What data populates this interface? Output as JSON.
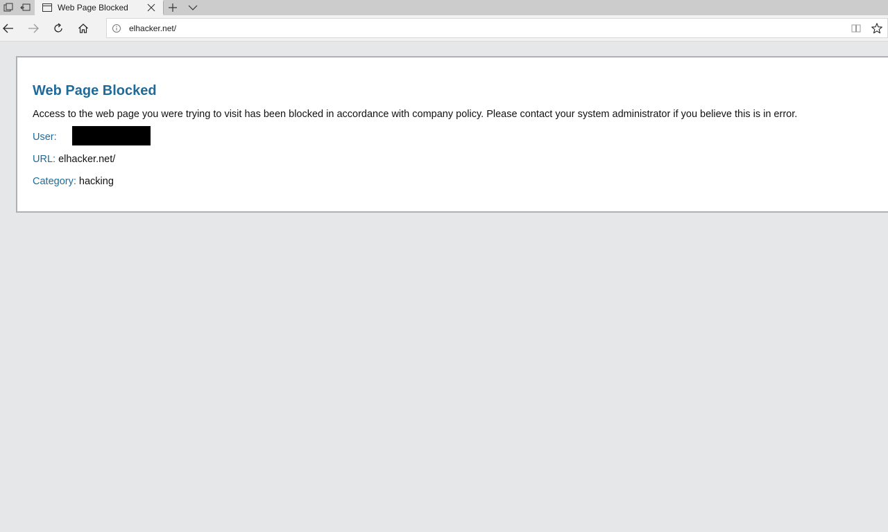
{
  "browser": {
    "tab": {
      "title": "Web Page Blocked"
    },
    "address_bar": {
      "url": "elhacker.net/"
    }
  },
  "page": {
    "title": "Web Page Blocked",
    "message": "Access to the web page you were trying to visit has been blocked in accordance with company policy. Please contact your system administrator if you believe this is in error.",
    "fields": {
      "user_label": "User:",
      "url_label": "URL:",
      "url_value": "elhacker.net/",
      "category_label": "Category:",
      "category_value": "hacking"
    }
  },
  "colors": {
    "accent": "#1e6b9b",
    "tabbar_bg": "#cccccc",
    "toolbar_bg": "#f2f2f2",
    "page_bg": "#e6e7e9"
  }
}
